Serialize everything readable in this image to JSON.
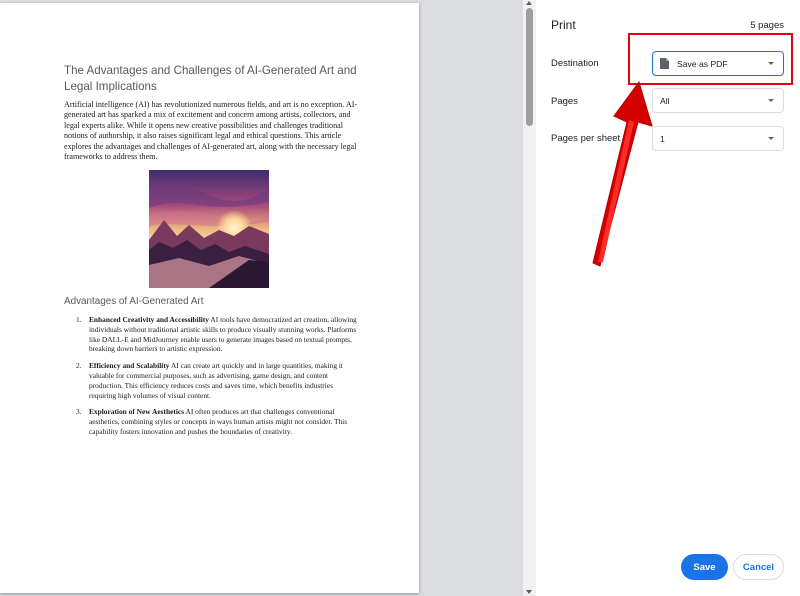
{
  "document": {
    "title": "The Advantages and Challenges of AI-Generated Art and Legal Implications",
    "intro": "Artificial intelligence (AI) has revolutionized numerous fields, and art is no exception. AI-generated art has sparked a mix of excitement and concern among artists, collectors, and legal experts alike. While it opens new creative possibilities and challenges traditional notions of authorship, it also raises significant legal and ethical questions. This article explores the advantages and challenges of AI-generated art, along with the necessary legal frameworks to address them.",
    "section_heading": "Advantages of AI-Generated Art",
    "list": [
      {
        "number": "1.",
        "heading": "Enhanced Creativity and Accessibility",
        "text": "AI tools have democratized art creation, allowing individuals without traditional artistic skills to produce visually stunning works. Platforms like DALL-E and MidJourney enable users to generate images based on textual prompts, breaking down barriers to artistic expression."
      },
      {
        "number": "2.",
        "heading": "Efficiency and Scalability",
        "text": "AI can create art quickly and in large quantities, making it valuable for commercial purposes, such as advertising, game design, and content production. This efficiency reduces costs and saves time, which benefits industries requiring high volumes of visual content."
      },
      {
        "number": "3.",
        "heading": "Exploration of New Aesthetics",
        "text": "AI often produces art that challenges conventional aesthetics, combining styles or concepts in ways human artists might not consider. This capability fosters innovation and pushes the boundaries of creativity."
      }
    ]
  },
  "print_panel": {
    "title": "Print",
    "page_count": "5 pages",
    "destination": {
      "label": "Destination",
      "value": "Save as PDF",
      "icon": "file-icon"
    },
    "pages": {
      "label": "Pages",
      "value": "All"
    },
    "pages_per_sheet": {
      "label": "Pages per sheet",
      "value": "1"
    },
    "save_label": "Save",
    "cancel_label": "Cancel"
  },
  "colors": {
    "accent": "#1a73e8",
    "annotation": "#e3000f",
    "preview_background": "#dadce0"
  }
}
